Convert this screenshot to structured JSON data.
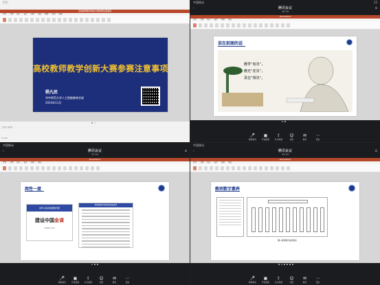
{
  "q1": {
    "status_left": "钉钉",
    "ppt_title": "高校教师教学创新大赛参赛注意事项",
    "slide": {
      "title": "高校教师教学创新大赛参赛注意事项",
      "author": "杨九民",
      "org": "华中师范大学人工智能教育学部",
      "date": "2024年11月"
    },
    "time_bottom": "14:30"
  },
  "q2": {
    "status_left": "中国移动",
    "status_right": "15",
    "meeting_title": "腾讯会议",
    "meeting_sub": "28:26",
    "slide": {
      "head": "说在前面的话",
      "quote": [
        "教学“有法”，",
        "教无“定法”，",
        "贵在“得法”。"
      ]
    },
    "toolbar": [
      {
        "icon": "mic-icon",
        "label": "解除静音"
      },
      {
        "icon": "camera-icon",
        "label": "开启视频"
      },
      {
        "icon": "share-icon",
        "label": "共享屏幕"
      },
      {
        "icon": "members-icon",
        "label": "成员"
      },
      {
        "icon": "chat-icon",
        "label": "聊天"
      },
      {
        "icon": "more-icon",
        "label": "更多"
      }
    ]
  },
  "q3": {
    "status_left": "中国移动",
    "meeting_title": "腾讯会议",
    "meeting_sub": "33:04",
    "slide": {
      "head": "两性一度",
      "card_band": "中华人民共和国教育部",
      "card_big_a": "建设中国",
      "card_big_b": "金课",
      "card_sub": "2018.11.24",
      "doc_head": "国家级教学创新团队建设要求"
    },
    "toolbar": [
      {
        "icon": "mic-icon",
        "label": "解除静音"
      },
      {
        "icon": "camera-icon",
        "label": "开启视频"
      },
      {
        "icon": "share-icon",
        "label": "共享屏幕"
      },
      {
        "icon": "members-icon",
        "label": "成员"
      },
      {
        "icon": "chat-icon",
        "label": "聊天"
      },
      {
        "icon": "more-icon",
        "label": "更多"
      }
    ]
  },
  "q4": {
    "status_left": "中国移动",
    "meeting_title": "腾讯会议",
    "meeting_sub": "39:43",
    "slide": {
      "head": "教师数字素养",
      "caption": "图1 教师数字素养框架"
    },
    "toolbar": [
      {
        "icon": "mic-icon",
        "label": "解除静音"
      },
      {
        "icon": "camera-icon",
        "label": "开启视频"
      },
      {
        "icon": "share-icon",
        "label": "共享屏幕"
      },
      {
        "icon": "members-icon",
        "label": "成员"
      },
      {
        "icon": "chat-icon",
        "label": "聊天"
      },
      {
        "icon": "more-icon",
        "label": "更多"
      }
    ]
  },
  "colors": {
    "ppt_red": "#b7472a",
    "slide_navy": "#1d2e7a",
    "title_gold": "#f2c12e",
    "heading_blue": "#1d3a8a",
    "mute_red": "#e24b4b"
  }
}
